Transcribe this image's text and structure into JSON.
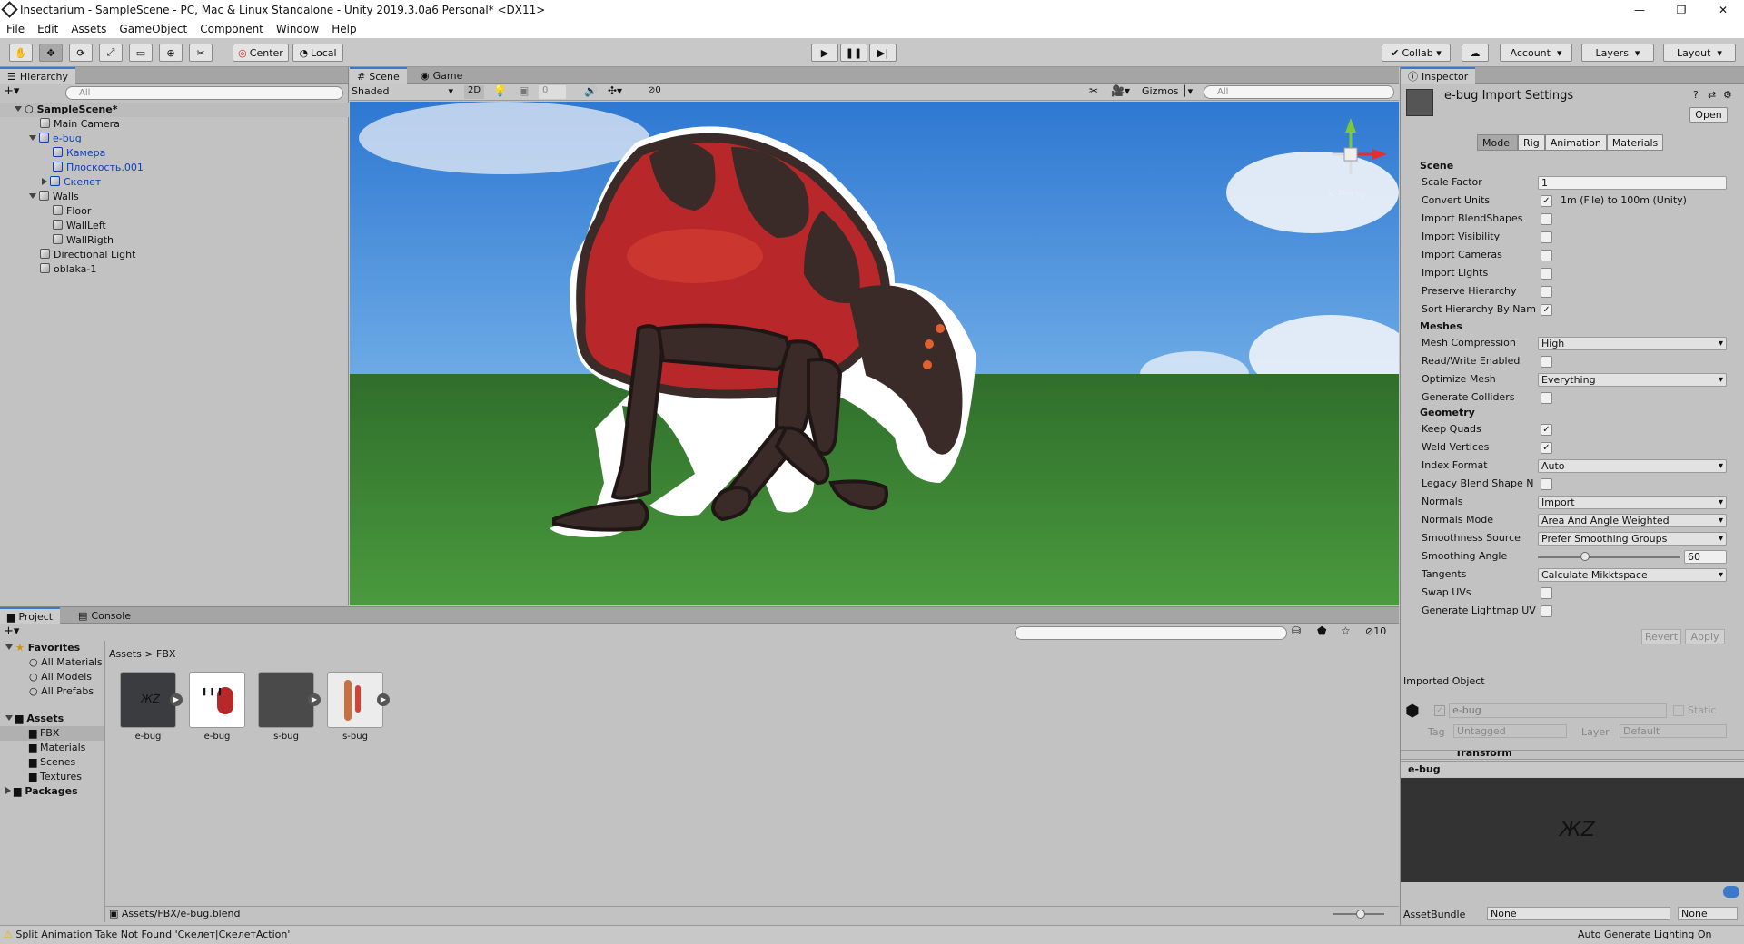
{
  "window": {
    "title": "Insectarium - SampleScene - PC, Mac & Linux Standalone - Unity 2019.3.0a6 Personal* <DX11>"
  },
  "menu": [
    "File",
    "Edit",
    "Assets",
    "GameObject",
    "Component",
    "Window",
    "Help"
  ],
  "toolbar": {
    "pivot": "Center",
    "space": "Local",
    "collab": "Collab",
    "account": "Account",
    "layers": "Layers",
    "layout": "Layout"
  },
  "hierarchy": {
    "tab": "Hierarchy",
    "search_placeholder": "All",
    "items": [
      {
        "label": "SampleScene*"
      },
      {
        "label": "Main Camera"
      },
      {
        "label": "e-bug"
      },
      {
        "label": "Камера"
      },
      {
        "label": "Плоскость.001"
      },
      {
        "label": "Скелет"
      },
      {
        "label": "Walls"
      },
      {
        "label": "Floor"
      },
      {
        "label": "WallLeft"
      },
      {
        "label": "WallRigth"
      },
      {
        "label": "Directional Light"
      },
      {
        "label": "oblaka-1"
      }
    ]
  },
  "scene": {
    "tabs": [
      "Scene",
      "Game"
    ],
    "shading": "Shaded",
    "mode2d": "2D",
    "effects_count": "0",
    "hidden_count": "0",
    "gizmos": "Gizmos",
    "search_placeholder": "All",
    "persp": "< Persp"
  },
  "inspector": {
    "tab": "Inspector",
    "title": "e-bug Import Settings",
    "open": "Open",
    "tabs": [
      "Model",
      "Rig",
      "Animation",
      "Materials"
    ],
    "sections": {
      "scene": "Scene",
      "meshes": "Meshes",
      "geometry": "Geometry"
    },
    "scene_rows": [
      {
        "label": "Scale Factor",
        "value": "1"
      },
      {
        "label": "Convert Units",
        "value": "1m (File) to 100m (Unity)",
        "checked": true
      },
      {
        "label": "Import BlendShapes",
        "checked": false
      },
      {
        "label": "Import Visibility",
        "checked": false
      },
      {
        "label": "Import Cameras",
        "checked": false
      },
      {
        "label": "Import Lights",
        "checked": false
      },
      {
        "label": "Preserve Hierarchy",
        "checked": false
      },
      {
        "label": "Sort Hierarchy By Nam",
        "checked": true
      }
    ],
    "mesh_rows": [
      {
        "label": "Mesh Compression",
        "value": "High"
      },
      {
        "label": "Read/Write Enabled",
        "checked": false
      },
      {
        "label": "Optimize Mesh",
        "value": "Everything"
      },
      {
        "label": "Generate Colliders",
        "checked": false
      }
    ],
    "geometry_rows": [
      {
        "label": "Keep Quads",
        "checked": true
      },
      {
        "label": "Weld Vertices",
        "checked": true
      },
      {
        "label": "Index Format",
        "value": "Auto"
      },
      {
        "label": "Legacy Blend Shape N",
        "checked": false
      },
      {
        "label": "Normals",
        "value": "Import"
      },
      {
        "label": "Normals Mode",
        "value": "Area And Angle Weighted"
      },
      {
        "label": "Smoothness Source",
        "value": "Prefer Smoothing Groups"
      },
      {
        "label": "Smoothing Angle",
        "value": "60"
      },
      {
        "label": "Tangents",
        "value": "Calculate Mikktspace"
      },
      {
        "label": "Swap UVs",
        "checked": false
      },
      {
        "label": "Generate Lightmap UV",
        "checked": false
      }
    ],
    "smoothing_angle_fraction": 0.33,
    "revert": "Revert",
    "apply": "Apply",
    "imported_object": "Imported Object",
    "object_name": "e-bug",
    "static": "Static",
    "tag_label": "Tag",
    "tag_value": "Untagged",
    "layer_label": "Layer",
    "layer_value": "Default",
    "transform": "Transform",
    "preview_title": "e-bug",
    "assetbundle_label": "AssetBundle",
    "assetbundle_value": "None",
    "assetbundle_variant": "None",
    "lighting": "Auto Generate Lighting On"
  },
  "project": {
    "tabs": [
      "Project",
      "Console"
    ],
    "favorites": "Favorites",
    "fav_items": [
      "All Materials",
      "All Models",
      "All Prefabs"
    ],
    "assets": "Assets",
    "asset_folders": [
      "FBX",
      "Materials",
      "Scenes",
      "Textures"
    ],
    "packages": "Packages",
    "breadcrumb": [
      "Assets",
      "FBX"
    ],
    "layer_count": "10",
    "files": [
      {
        "label": "e-bug",
        "kind": "model"
      },
      {
        "label": "e-bug",
        "kind": "texture"
      },
      {
        "label": "s-bug",
        "kind": "model"
      },
      {
        "label": "s-bug",
        "kind": "texture"
      }
    ],
    "selected_path": "Assets/FBX/e-bug.blend"
  },
  "status": {
    "message": "Split Animation Take Not Found 'Скелет|СкелетAction'"
  },
  "colors": {
    "accent": "#3c78c8",
    "bug_red": "#b8282a",
    "bug_dark": "#3a2a28",
    "sky": "#3f86d8",
    "grass": "#3f8a35",
    "warning": "#e8b400"
  }
}
